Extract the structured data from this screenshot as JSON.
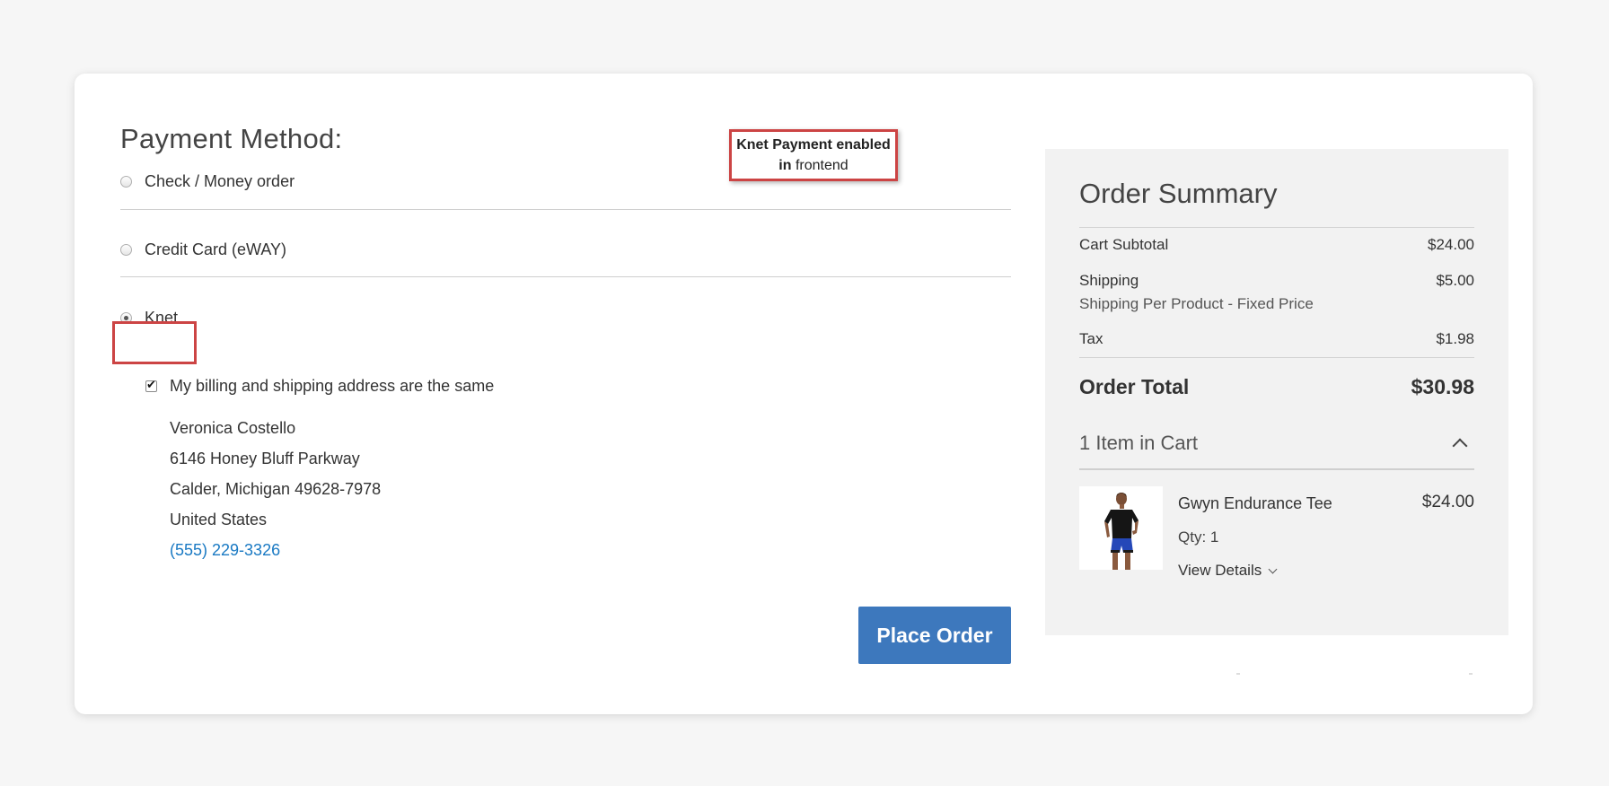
{
  "payment": {
    "title": "Payment Method:",
    "methods": [
      {
        "label": "Check / Money order",
        "selected": false
      },
      {
        "label": "Credit Card (eWAY)",
        "selected": false
      },
      {
        "label": "Knet",
        "selected": true
      }
    ],
    "billing_same_label": "My billing and shipping address are the same",
    "billing_same_checked": true,
    "address": {
      "name": "Veronica Costello",
      "street": "6146 Honey Bluff Parkway",
      "city_line": "Calder, Michigan 49628-7978",
      "country": "United States",
      "phone": "(555) 229-3326"
    },
    "place_order_label": "Place Order"
  },
  "callout": {
    "line1_bold": "Knet Payment enabled",
    "line2_bold": "in",
    "line2_rest": "frontend"
  },
  "summary": {
    "title": "Order Summary",
    "cart_subtotal_label": "Cart Subtotal",
    "cart_subtotal_value": "$24.00",
    "shipping_label": "Shipping",
    "shipping_value": "$5.00",
    "shipping_method": "Shipping Per Product - Fixed Price",
    "tax_label": "Tax",
    "tax_value": "$1.98",
    "order_total_label": "Order Total",
    "order_total_value": "$30.98",
    "items_in_cart": "1 Item in Cart",
    "item": {
      "name": "Gwyn Endurance Tee",
      "price": "$24.00",
      "qty": "Qty: 1",
      "view_details": "View Details"
    }
  },
  "colors": {
    "accent_blue": "#3d78bd",
    "link_blue": "#1979c3",
    "highlight_red": "#cc4444"
  }
}
